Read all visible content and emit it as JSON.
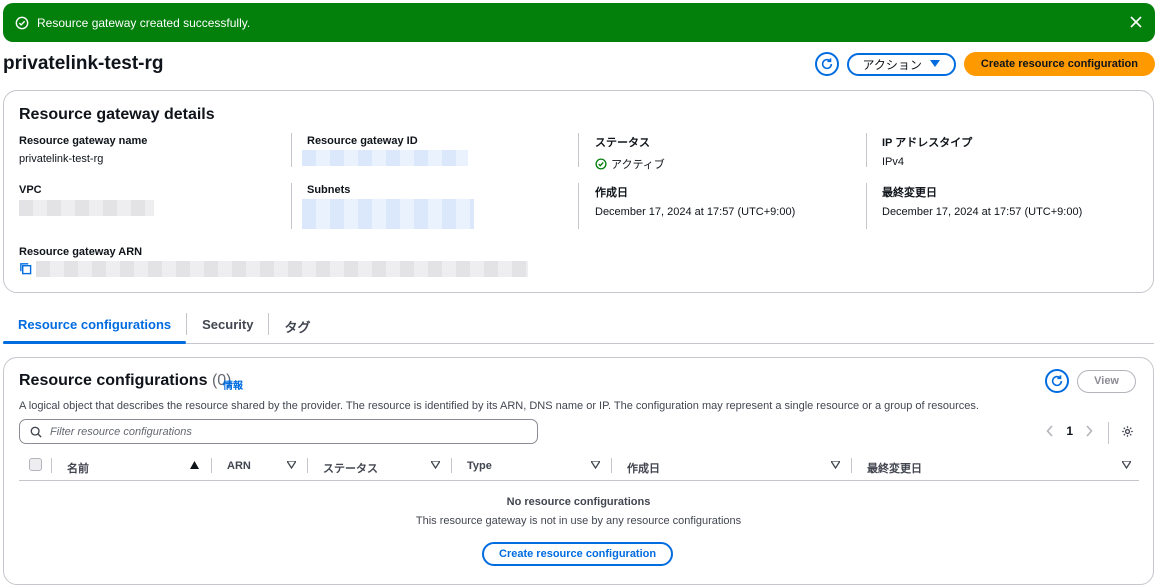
{
  "flash": {
    "message": "Resource gateway created successfully."
  },
  "header": {
    "title": "privatelink-test-rg",
    "actions_label": "アクション",
    "create_label": "Create resource configuration"
  },
  "details": {
    "heading": "Resource gateway details",
    "name_label": "Resource gateway name",
    "name_value": "privatelink-test-rg",
    "id_label": "Resource gateway ID",
    "status_label": "ステータス",
    "status_value": "アクティブ",
    "ip_label": "IP アドレスタイプ",
    "ip_value": "IPv4",
    "vpc_label": "VPC",
    "subnets_label": "Subnets",
    "created_label": "作成日",
    "created_value": "December 17, 2024 at 17:57 (UTC+9:00)",
    "modified_label": "最終変更日",
    "modified_value": "December 17, 2024 at 17:57 (UTC+9:00)",
    "arn_label": "Resource gateway ARN"
  },
  "tabs": [
    "Resource configurations",
    "Security",
    "タグ"
  ],
  "rc": {
    "title": "Resource configurations",
    "count": "(0)",
    "info": "情報",
    "description": "A logical object that describes the resource shared by the provider. The resource is identified by its ARN, DNS name or IP. The configuration may represent a single resource or a group of resources.",
    "view_label": "View",
    "filter_placeholder": "Filter resource configurations",
    "page": "1",
    "columns": [
      "名前",
      "ARN",
      "ステータス",
      "Type",
      "作成日",
      "最終変更日"
    ],
    "empty_title": "No resource configurations",
    "empty_sub": "This resource gateway is not in use by any resource configurations",
    "empty_button": "Create resource configuration"
  },
  "colors": {
    "primary": "#006ce0",
    "success": "#037f0c",
    "cta": "#ff9900"
  }
}
